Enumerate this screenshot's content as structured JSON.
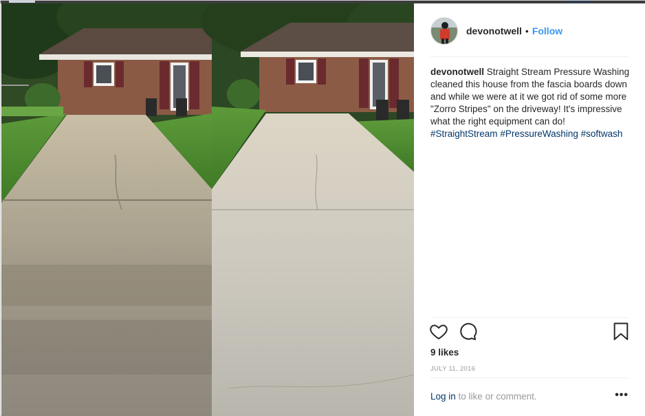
{
  "post": {
    "username": "devonotwell",
    "separator": "•",
    "follow_label": "Follow",
    "caption_text": "Straight Stream Pressure Washing cleaned this house from the fascia boards down and while we were at it we got rid of some more \"Zorro Stripes\" on the driveway! It's impressive what the right equipment can do!",
    "hashtags": [
      "#StraightStream",
      "#PressureWashing",
      "#softwash"
    ],
    "likes": "9 likes",
    "date": "JULY 11, 2016",
    "login_link": "Log in",
    "login_suffix": " to like or comment.",
    "more_label": "•••"
  },
  "icons": {
    "like": "heart-icon",
    "comment": "comment-icon",
    "save": "bookmark-icon",
    "more": "more-options-icon"
  },
  "colors": {
    "link_blue": "#3897f0",
    "hashtag_blue": "#003569",
    "muted_gray": "#999999"
  }
}
